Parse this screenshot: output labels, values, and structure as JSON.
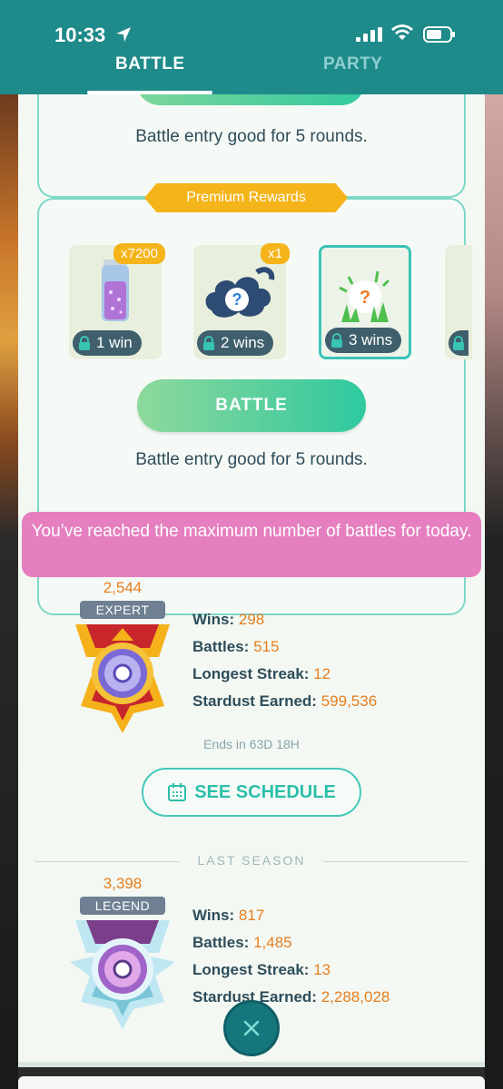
{
  "status_bar": {
    "time": "10:33"
  },
  "tabs": {
    "battle": "BATTLE",
    "party": "PARTY"
  },
  "card_prev": {
    "entry_text": "Battle entry good for 5 rounds."
  },
  "premium": {
    "banner": "Premium Rewards",
    "rewards": [
      {
        "count": "x7200",
        "wins": "1 win",
        "icon": "stardust-jar-icon"
      },
      {
        "count": "x1",
        "wins": "2 wins",
        "icon": "mystery-cloud-icon"
      },
      {
        "count": "",
        "wins": "3 wins",
        "icon": "mystery-encounter-icon"
      }
    ],
    "battle_button": "BATTLE",
    "entry_text": "Battle entry good for 5 rounds."
  },
  "notice": "You’ve reached the maximum number of battles for today.",
  "current": {
    "rating": "2,544",
    "rank": "EXPERT",
    "wins_label": "Wins:",
    "wins": "298",
    "battles_label": "Battles:",
    "battles": "515",
    "streak_label": "Longest Streak:",
    "streak": "12",
    "stardust_label": "Stardust Earned:",
    "stardust": "599,536"
  },
  "ends": "Ends in 63D 18H",
  "schedule_button": "SEE SCHEDULE",
  "last_season": {
    "label": "LAST SEASON",
    "rating": "3,398",
    "rank": "LEGEND",
    "wins_label": "Wins:",
    "wins": "817",
    "battles_label": "Battles:",
    "battles": "1,485",
    "streak_label": "Longest Streak:",
    "streak": "13",
    "stardust_label": "Stardust Earned:",
    "stardust": "2,288,028"
  },
  "colors": {
    "teal": "#1f8a8a",
    "orange": "#e67e1e",
    "gold": "#f5b41a",
    "pink": "#e57fbf"
  }
}
